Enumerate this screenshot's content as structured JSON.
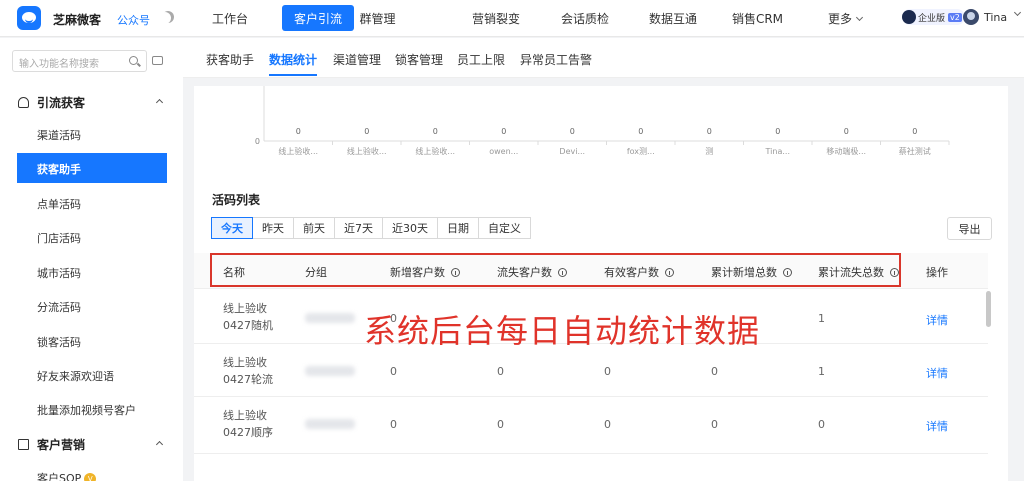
{
  "app": {
    "brand": "芝麻微客",
    "account": "公众号",
    "theme_icon": "moon-icon"
  },
  "top_nav": [
    "工作台",
    "客户引流",
    "群管理",
    "营销裂变",
    "会话质检",
    "数据互通",
    "销售CRM",
    "更多"
  ],
  "top_nav_active": "客户引流",
  "user": {
    "edition": "企业版",
    "edition_level": "v2",
    "name": "Tina"
  },
  "sidebar": {
    "search_placeholder": "输入功能名称搜索",
    "groups": [
      {
        "title": "引流获客",
        "items": [
          "渠道活码",
          "获客助手",
          "点单活码",
          "门店活码",
          "城市活码",
          "分流活码",
          "锁客活码",
          "好友来源欢迎语",
          "批量添加视频号客户"
        ]
      },
      {
        "title": "客户营销",
        "items": [
          "客户SOP"
        ]
      }
    ],
    "active_item": "获客助手",
    "vip_badge": "V"
  },
  "sub_tabs": [
    "获客助手",
    "数据统计",
    "渠道管理",
    "锁客管理",
    "员工上限",
    "异常员工告警"
  ],
  "sub_tab_active": "数据统计",
  "chart_data": {
    "type": "bar",
    "categories": [
      "线上验收...",
      "线上验收...",
      "线上验收...",
      "owen...",
      "Devi...",
      "fox测...",
      "测",
      "Tina...",
      "移动端极...",
      "蔡社测试"
    ],
    "values": [
      0,
      0,
      0,
      0,
      0,
      0,
      0,
      0,
      0,
      0
    ],
    "y_tick_label": "0"
  },
  "list": {
    "title": "活码列表",
    "filters": [
      "今天",
      "昨天",
      "前天",
      "近7天",
      "近30天",
      "日期",
      "自定义"
    ],
    "filter_active": "今天",
    "export_label": "导出",
    "columns": [
      "名称",
      "分组",
      "新增客户数",
      "流失客户数",
      "有效客户数",
      "累计新增总数",
      "累计流失总数",
      "操作"
    ],
    "rows": [
      {
        "name_line1": "线上验收",
        "name_line2": "0427随机",
        "new": "0",
        "lost": "",
        "valid": "",
        "total_new": "",
        "total_lost": "1",
        "action": "详情"
      },
      {
        "name_line1": "线上验收",
        "name_line2": "0427轮流",
        "new": "0",
        "lost": "0",
        "valid": "0",
        "total_new": "0",
        "total_lost": "1",
        "action": "详情"
      },
      {
        "name_line1": "线上验收",
        "name_line2": "0427顺序",
        "new": "0",
        "lost": "0",
        "valid": "0",
        "total_new": "0",
        "total_lost": "0",
        "action": "详情"
      }
    ]
  },
  "overlay_text": "系统后台每日自动统计数据",
  "colors": {
    "accent": "#1677ff",
    "highlight": "#d9362b",
    "overlay": "#e0332a"
  }
}
